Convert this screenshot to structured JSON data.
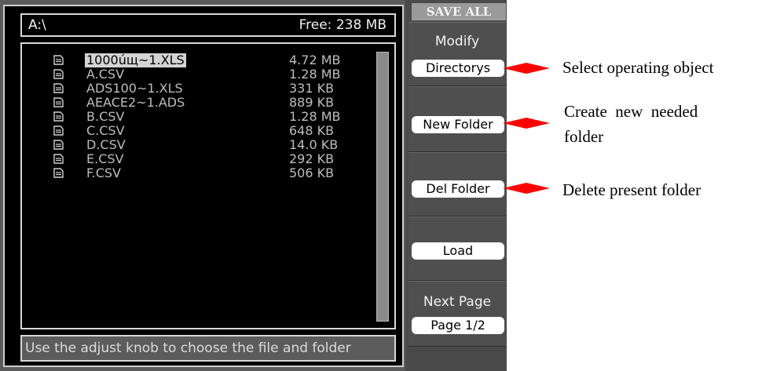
{
  "screen": {
    "path": "A:\\",
    "free_space": "Free: 238 MB",
    "status_hint": "Use the adjust knob to choose the file and folder",
    "files": [
      {
        "name": "1000úщ~1.XLS",
        "size": "4.72 MB",
        "selected": true
      },
      {
        "name": "A.CSV",
        "size": "1.28 MB"
      },
      {
        "name": "ADS100~1.XLS",
        "size": "331 KB"
      },
      {
        "name": "AEACE2~1.ADS",
        "size": "889 KB"
      },
      {
        "name": "B.CSV",
        "size": "1.28 MB"
      },
      {
        "name": "C.CSV",
        "size": "648 KB"
      },
      {
        "name": "D.CSV",
        "size": "14.0 KB"
      },
      {
        "name": "E.CSV",
        "size": "292 KB"
      },
      {
        "name": "F.CSV",
        "size": "506 KB"
      }
    ]
  },
  "menu": {
    "title": "SAVE ALL",
    "modify_label": "Modify",
    "modify_value": "Directorys",
    "new_folder": "New Folder",
    "del_folder": "Del Folder",
    "load": "Load",
    "next_page_label": "Next Page",
    "next_page_value": "Page 1/2"
  },
  "annotations": {
    "select": "Select operating object",
    "create_line1": "Create  new  needed",
    "create_line2": "folder",
    "delete": "Delete present folder"
  },
  "colors": {
    "arrow": "#ff0000"
  }
}
